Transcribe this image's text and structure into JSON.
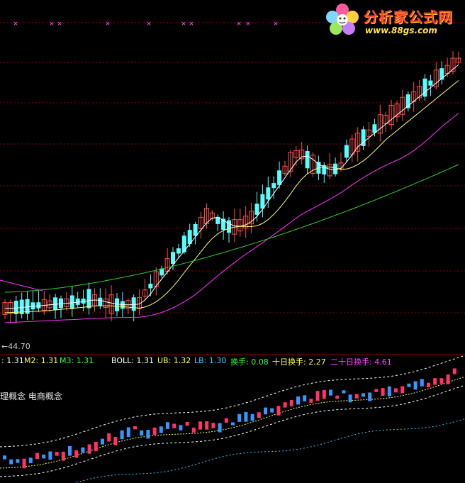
{
  "price_panel": {
    "low_marker": "←44.70"
  },
  "indicator_bar": {
    "m1": ": 1.31",
    "m2": "M2: 1.31",
    "m3": "M3: 1.31",
    "boll": "BOLL: 1.31",
    "ub": "UB: 1.32",
    "lb": "LB: 1.30",
    "turnover": "换手: 0.08",
    "turnover10": "十日换手: 2.27",
    "turnover20": "二十日换手: 4.61"
  },
  "concept_text": "理概念 电商概念",
  "watermark": {
    "title": "分析家公式网",
    "url": "www.88gs.com"
  },
  "colors": {
    "background": "#000000",
    "grid": "#8b0000",
    "up_candle": "#ff4d4d",
    "down_candle": "#54ffff",
    "ma_short": "#ffffff",
    "ma_mid": "#ffff66",
    "ma_long": "#ff33ff",
    "ma_longest": "#33cc33",
    "m1_text": "#ffffff",
    "m2_text": "#ffff55",
    "m3_text": "#33ff33",
    "boll_text": "#ffffff",
    "ub_text": "#ffff55",
    "lb_text": "#33ccff",
    "turnover_text": "#33ff33",
    "turnover10_text": "#ffff55",
    "turnover20_text": "#ff44ff"
  }
}
